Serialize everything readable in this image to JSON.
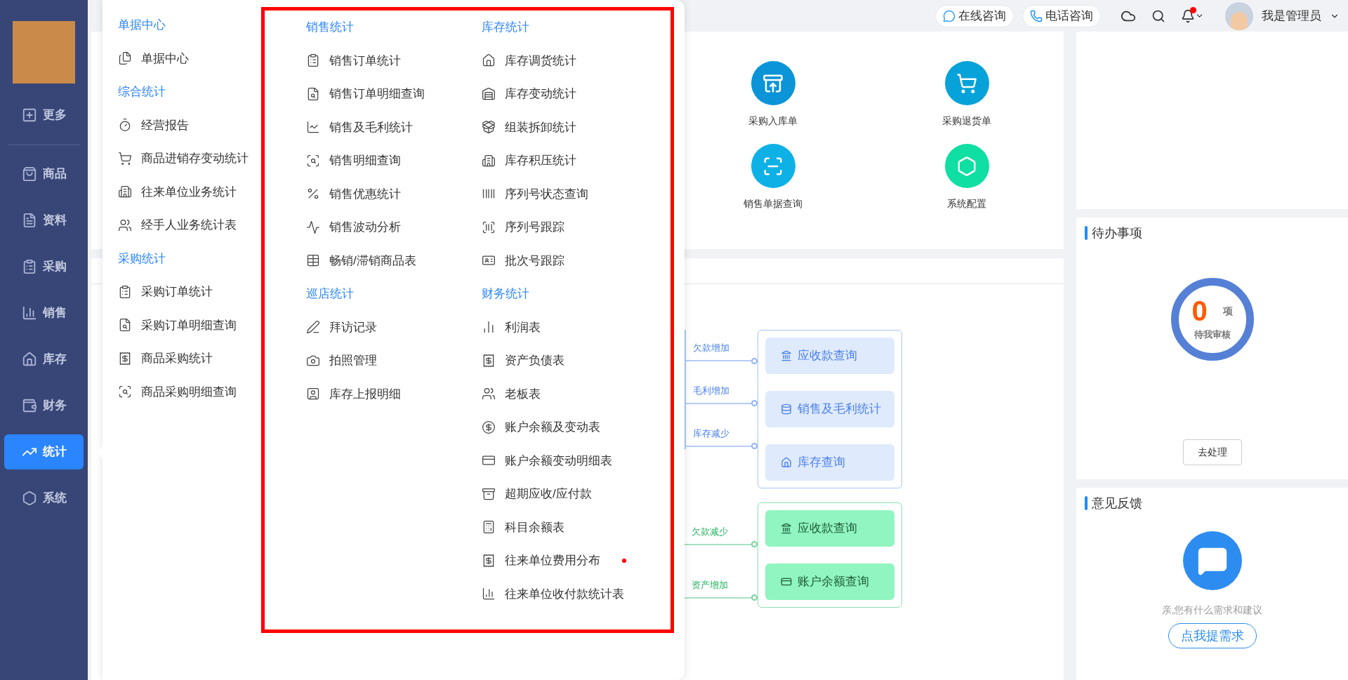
{
  "sidebar": {
    "items": [
      {
        "label": "更多",
        "selected": false
      },
      {
        "label": "商品",
        "selected": false
      },
      {
        "label": "资料",
        "selected": false
      },
      {
        "label": "采购",
        "selected": false
      },
      {
        "label": "销售",
        "selected": false
      },
      {
        "label": "库存",
        "selected": false
      },
      {
        "label": "财务",
        "selected": false
      },
      {
        "label": "统计",
        "selected": true
      },
      {
        "label": "系统",
        "selected": false
      }
    ]
  },
  "top_bar": {
    "consult_buttons": [
      "在线咨询",
      "电话咨询"
    ],
    "notification": true,
    "user_name": "我是管理员"
  },
  "menu": {
    "columns": [
      {
        "sections": [
          {
            "title": "单据中心",
            "items": [
              {
                "label": "单据中心",
                "dot": false
              }
            ]
          },
          {
            "title": "综合统计",
            "items": [
              {
                "label": "经营报告",
                "dot": false
              },
              {
                "label": "商品进销存变动统计",
                "dot": false
              },
              {
                "label": "往来单位业务统计",
                "dot": false
              },
              {
                "label": "经手人业务统计表",
                "dot": false
              }
            ]
          },
          {
            "title": "采购统计",
            "items": [
              {
                "label": "采购订单统计",
                "dot": false
              },
              {
                "label": "采购订单明细查询",
                "dot": false
              },
              {
                "label": "商品采购统计",
                "dot": false
              },
              {
                "label": "商品采购明细查询",
                "dot": false
              }
            ]
          }
        ]
      },
      {
        "sections": [
          {
            "title": "销售统计",
            "items": [
              {
                "label": "销售订单统计",
                "dot": false
              },
              {
                "label": "销售订单明细查询",
                "dot": false
              },
              {
                "label": "销售及毛利统计",
                "dot": false
              },
              {
                "label": "销售明细查询",
                "dot": false
              },
              {
                "label": "销售优惠统计",
                "dot": false
              },
              {
                "label": "销售波动分析",
                "dot": false
              },
              {
                "label": "畅销/滞销商品表",
                "dot": false
              }
            ]
          },
          {
            "title": "巡店统计",
            "items": [
              {
                "label": "拜访记录",
                "dot": false
              },
              {
                "label": "拍照管理",
                "dot": false
              },
              {
                "label": "库存上报明细",
                "dot": false
              }
            ]
          }
        ]
      },
      {
        "sections": [
          {
            "title": "库存统计",
            "items": [
              {
                "label": "库存调货统计",
                "dot": false
              },
              {
                "label": "库存变动统计",
                "dot": false
              },
              {
                "label": "组装拆卸统计",
                "dot": false
              },
              {
                "label": "库存积压统计",
                "dot": false
              },
              {
                "label": "序列号状态查询",
                "dot": false
              },
              {
                "label": "序列号跟踪",
                "dot": false
              },
              {
                "label": "批次号跟踪",
                "dot": false
              }
            ]
          },
          {
            "title": "财务统计",
            "items": [
              {
                "label": "利润表",
                "dot": false
              },
              {
                "label": "资产负债表",
                "dot": false
              },
              {
                "label": "老板表",
                "dot": false
              },
              {
                "label": "账户余额及变动表",
                "dot": false
              },
              {
                "label": "账户余额变动明细表",
                "dot": false
              },
              {
                "label": "超期应收/应付款",
                "dot": false
              },
              {
                "label": "科目余额表",
                "dot": false
              },
              {
                "label": "往来单位费用分布",
                "dot": true
              },
              {
                "label": "往来单位收付款统计表",
                "dot": false
              }
            ]
          }
        ]
      }
    ]
  },
  "quick_actions": [
    {
      "label": "采购入库单",
      "color": "#0b94d8"
    },
    {
      "label": "采购退货单",
      "color": "#06a2d9"
    },
    {
      "label": "销售单据查询",
      "color": "#0eb1e6"
    },
    {
      "label": "系统配置",
      "color": "#0fdfa2"
    }
  ],
  "flow_groups": [
    {
      "color": "#4a80e8",
      "branches": [
        {
          "branch_label": "欠款增加",
          "button_label": "应收款查询"
        },
        {
          "branch_label": "毛利增加",
          "button_label": "销售及毛利统计"
        },
        {
          "branch_label": "库存减少",
          "button_label": "库存查询"
        }
      ]
    },
    {
      "color": "#22b35e",
      "branches": [
        {
          "branch_label": "欠款减少",
          "button_label": "应收款查询"
        },
        {
          "branch_label": "资产增加",
          "button_label": "账户余额查询"
        }
      ]
    }
  ],
  "todo": {
    "title": "待办事项",
    "count": "0",
    "unit": "项",
    "caption": "待我审核",
    "button": "去处理"
  },
  "feedback": {
    "title": "意见反馈",
    "prompt": "亲,您有什么需求和建议",
    "button": "点我提需求"
  }
}
